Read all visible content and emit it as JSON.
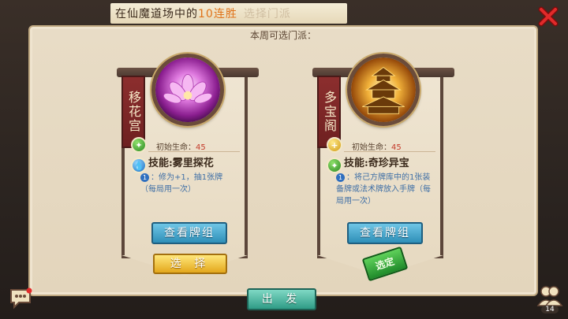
{
  "top_banner": {
    "prefix": "在仙魔道场中的",
    "highlight": "10连胜",
    "faded": "选择门派"
  },
  "panel": {
    "subtitle": "本周可选门派："
  },
  "cards": [
    {
      "name": "移花宫",
      "hp_label": "初始生命：",
      "hp_value": "45",
      "gems": [
        "green",
        "blue"
      ],
      "skill_title": "技能:雾里探花",
      "skill_badge": "1",
      "skill_desc": "：修为+1，抽1张牌（每局用一次）",
      "view_label": "查看牌组",
      "select_label": "选 择"
    },
    {
      "name": "多宝阁",
      "hp_label": "初始生命：",
      "hp_value": "45",
      "gems": [
        "yellow",
        "green"
      ],
      "skill_title": "技能:奇珍异宝",
      "skill_badge": "1",
      "skill_desc": "：将己方牌库中的1张装备牌或法术牌放入手牌（每局用一次）",
      "view_label": "查看牌组",
      "stamp_label": "选定"
    }
  ],
  "footer": {
    "depart_label": "出 发",
    "friends_count": "14"
  },
  "icons": {
    "close": "close-icon",
    "chat": "chat-icon",
    "friends": "friends-icon"
  },
  "colors": {
    "accent_orange": "#e0731a",
    "hp_red": "#c43a2a",
    "skill_blue": "#3f6fa6",
    "view_button": "#2e8fb8",
    "select_button": "#e3a71c",
    "stamp_green": "#1f8a2a"
  }
}
